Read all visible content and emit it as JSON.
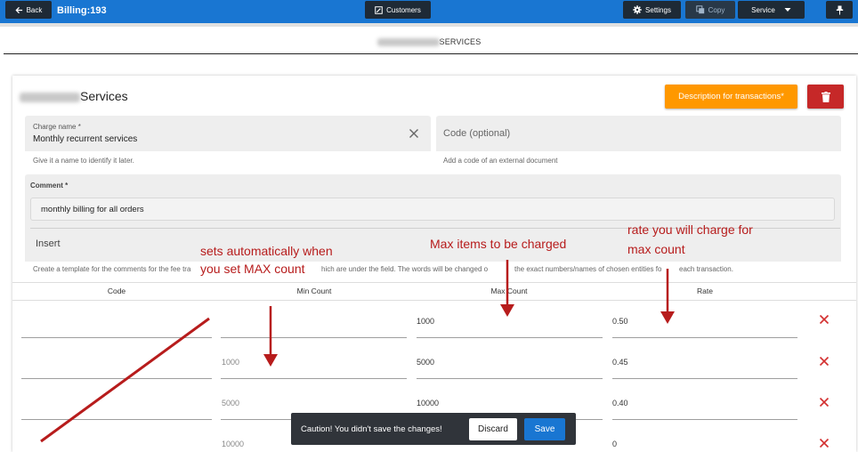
{
  "topbar": {
    "back_label": "Back",
    "title": "Billing:193",
    "customers_label": "Customers",
    "settings_label": "Settings",
    "copy_label": "Copy",
    "service_label": "Service"
  },
  "section": {
    "title_suffix": "SERVICES"
  },
  "card": {
    "title_suffix": "Services",
    "description_button": "Description for transactions*"
  },
  "form": {
    "charge_name": {
      "label": "Charge name *",
      "value": "Monthly recurrent services",
      "hint": "Give it a name to identify it later."
    },
    "code": {
      "placeholder": "Code (optional)",
      "hint": "Add a code of an external document"
    },
    "comment": {
      "label": "Comment *",
      "value": "monthly billing for all orders",
      "insert_label": "Insert",
      "hint_left": "Create a template for the comments for the fee tra",
      "hint_mid": "hich are under the field. The words will be changed o",
      "hint_right": "the exact numbers/names of chosen entities fo",
      "hint_end": "each transaction."
    }
  },
  "table": {
    "headers": [
      "Code",
      "Min Count",
      "Max Count",
      "Rate"
    ],
    "rows": [
      {
        "code": "",
        "min": "",
        "max": "1000",
        "rate": "0.50"
      },
      {
        "code": "",
        "min": "1000",
        "max": "5000",
        "rate": "0.45"
      },
      {
        "code": "",
        "min": "5000",
        "max": "10000",
        "rate": "0.40"
      },
      {
        "code": "",
        "min": "10000",
        "max": "",
        "rate": "0"
      }
    ]
  },
  "annotations": {
    "min_line1": "sets automatically when",
    "min_line2": "you set MAX count",
    "max_text": "Max items to be charged",
    "rate_line1": "rate you will charge for",
    "rate_line2": "max count"
  },
  "toast": {
    "message": "Caution! You didn't save the changes!",
    "discard_label": "Discard",
    "save_label": "Save"
  },
  "colors": {
    "topbar": "#1976d2",
    "accent_orange": "#ff9800",
    "danger_red": "#c62828",
    "annotation_red": "#b71c1c",
    "toast_bg": "#30343a"
  }
}
